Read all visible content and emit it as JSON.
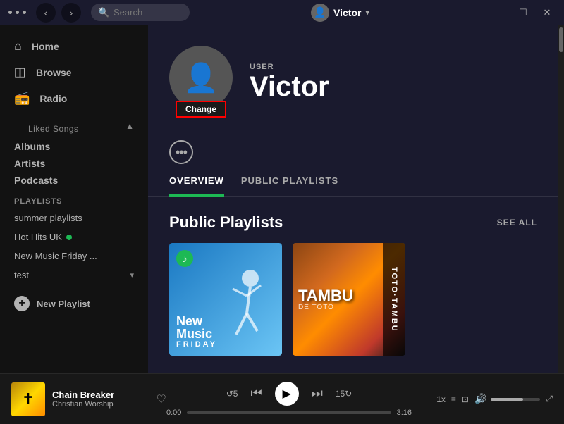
{
  "titlebar": {
    "dots": [
      "dot",
      "dot",
      "dot"
    ],
    "nav_back": "‹",
    "nav_forward": "›",
    "search_placeholder": "Search",
    "search_icon": "🔍",
    "user_name": "Victor",
    "window_minimize": "—",
    "window_maximize": "☐",
    "window_close": "✕"
  },
  "sidebar": {
    "nav_items": [
      {
        "label": "Home",
        "icon": "⌂"
      },
      {
        "label": "Browse",
        "icon": "◫"
      },
      {
        "label": "Radio",
        "icon": "📡"
      }
    ],
    "library_label": "Liked Songs",
    "library_items": [
      {
        "label": "Albums"
      },
      {
        "label": "Artists"
      },
      {
        "label": "Podcasts"
      }
    ],
    "playlists_label": "PLAYLISTS",
    "playlists": [
      {
        "label": "summer playlists",
        "dot": false
      },
      {
        "label": "Hot Hits UK",
        "dot": true
      },
      {
        "label": "New Music Friday ...",
        "dot": false
      },
      {
        "label": "test",
        "collapse": true
      }
    ],
    "new_playlist_label": "New Playlist"
  },
  "profile": {
    "user_label": "USER",
    "name": "Victor",
    "change_btn": "Change",
    "more_btn": "•••"
  },
  "tabs": [
    {
      "label": "OVERVIEW",
      "active": true
    },
    {
      "label": "PUBLIC PLAYLISTS",
      "active": false
    }
  ],
  "public_playlists": {
    "title": "Public Playlists",
    "see_all": "SEE ALL",
    "cards": [
      {
        "id": "new-music-friday",
        "title": "New Music Friday",
        "type": "nmf"
      },
      {
        "id": "tambu",
        "title": "Tambu",
        "type": "tambu"
      }
    ]
  },
  "now_playing": {
    "track": "Chain Breaker",
    "artist": "Christian Worship",
    "time_current": "0:00",
    "time_total": "3:16",
    "progress_pct": 0,
    "volume_pct": 65,
    "speed": "1x"
  }
}
